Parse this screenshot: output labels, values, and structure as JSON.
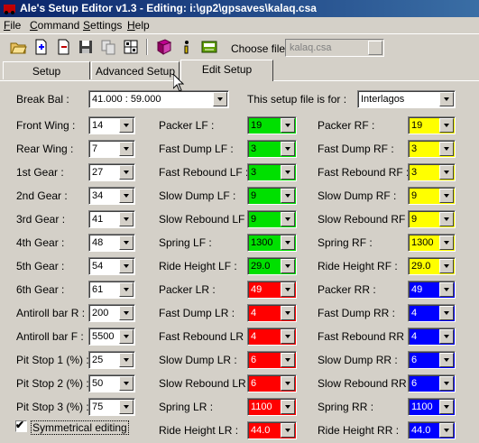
{
  "window": {
    "title": "Ale's Setup Editor v1.3 - Editing: i:\\gp2\\gpsaves\\kalaq.csa"
  },
  "menu": [
    {
      "pre": "",
      "ul": "F",
      "post": "ile"
    },
    {
      "pre": "",
      "ul": "C",
      "post": "ommand"
    },
    {
      "pre": "",
      "ul": "S",
      "post": "ettings"
    },
    {
      "pre": "",
      "ul": "H",
      "post": "elp"
    }
  ],
  "toolbar": {
    "icons": [
      "open-folder-icon",
      "new-icon",
      "delete-icon",
      "save-icon",
      "copy-icon",
      "grid-icon",
      "book-icon",
      "info-icon",
      "export-icon"
    ],
    "choose_label": "Choose file :",
    "file_value": "kalaq.csa"
  },
  "tabs": [
    "Setup",
    "Advanced Setup",
    "Edit Setup"
  ],
  "active_tab": "Edit Setup",
  "edit": {
    "break_bal_label": "Break Bal :",
    "break_bal_value": "41.000 : 59.000",
    "setup_for_label": "This setup file is for :",
    "setup_for_value": "Interlagos",
    "left_fields": [
      {
        "label": "Front Wing :",
        "value": "14"
      },
      {
        "label": "Rear Wing :",
        "value": "7"
      },
      {
        "label": "1st Gear :",
        "value": "27"
      },
      {
        "label": "2nd Gear :",
        "value": "34"
      },
      {
        "label": "3rd Gear :",
        "value": "41"
      },
      {
        "label": "4th Gear :",
        "value": "48"
      },
      {
        "label": "5th Gear :",
        "value": "54"
      },
      {
        "label": "6th Gear :",
        "value": "61"
      },
      {
        "label": "Antiroll bar R :",
        "value": "200"
      },
      {
        "label": "Antiroll bar F :",
        "value": "5500"
      },
      {
        "label": "Pit Stop 1 (%) :",
        "value": "25"
      },
      {
        "label": "Pit Stop 2 (%) :",
        "value": "50"
      },
      {
        "label": "Pit Stop 3 (%) :",
        "value": "75"
      }
    ],
    "front_left": [
      {
        "label": "Packer LF :",
        "value": "19"
      },
      {
        "label": "Fast Dump LF :",
        "value": "3"
      },
      {
        "label": "Fast Rebound LF :",
        "value": "3"
      },
      {
        "label": "Slow Dump LF :",
        "value": "9"
      },
      {
        "label": "Slow Rebound LF :",
        "value": "9"
      },
      {
        "label": "Spring LF :",
        "value": "1300"
      },
      {
        "label": "Ride Height LF :",
        "value": "29.0"
      }
    ],
    "front_right": [
      {
        "label": "Packer RF :",
        "value": "19"
      },
      {
        "label": "Fast Dump RF :",
        "value": "3"
      },
      {
        "label": "Fast Rebound RF :",
        "value": "3"
      },
      {
        "label": "Slow Dump RF :",
        "value": "9"
      },
      {
        "label": "Slow Rebound RF :",
        "value": "9"
      },
      {
        "label": "Spring RF :",
        "value": "1300"
      },
      {
        "label": "Ride Height RF :",
        "value": "29.0"
      }
    ],
    "rear_left": [
      {
        "label": "Packer LR :",
        "value": "49"
      },
      {
        "label": "Fast Dump LR :",
        "value": "4"
      },
      {
        "label": "Fast Rebound LR :",
        "value": "4"
      },
      {
        "label": "Slow Dump LR :",
        "value": "6"
      },
      {
        "label": "Slow Rebound LR :",
        "value": "6"
      },
      {
        "label": "Spring LR :",
        "value": "1100"
      },
      {
        "label": "Ride Height LR :",
        "value": "44.0"
      }
    ],
    "rear_right": [
      {
        "label": "Packer RR :",
        "value": "49"
      },
      {
        "label": "Fast Dump RR :",
        "value": "4"
      },
      {
        "label": "Fast Rebound RR :",
        "value": "4"
      },
      {
        "label": "Slow Dump RR :",
        "value": "6"
      },
      {
        "label": "Slow Rebound RR :",
        "value": "6"
      },
      {
        "label": "Spring RR :",
        "value": "1100"
      },
      {
        "label": "Ride Height RR :",
        "value": "44.0"
      }
    ],
    "symmetrical_label": "Symmetrical editing",
    "symmetrical_checked": true
  },
  "colors": {
    "left_front": "#00e000",
    "right_front": "#ffff00",
    "left_rear": "#ff0000",
    "right_rear": "#0000ff",
    "title_start": "#0a246a",
    "title_end": "#3a6ea5"
  }
}
